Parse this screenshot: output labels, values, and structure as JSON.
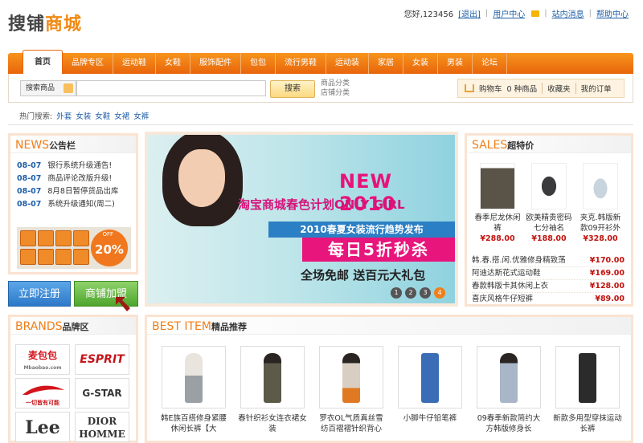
{
  "header": {
    "logo_part1": "搜铺",
    "logo_part2": "商城",
    "greeting": "您好,123456",
    "logout": "[退出]",
    "user_center": "用户中心",
    "messages": "站内消息",
    "help": "帮助中心"
  },
  "nav": {
    "tabs": [
      "首页",
      "品牌专区",
      "运动鞋",
      "女鞋",
      "服饰配件",
      "包包",
      "流行男鞋",
      "运动装",
      "家居",
      "女装",
      "男装",
      "论坛"
    ],
    "active_index": 0
  },
  "search": {
    "category": "搜索商品",
    "button": "搜索",
    "links": [
      "商品分类",
      "店铺分类"
    ]
  },
  "cart": {
    "cart_text": "购物车",
    "count_text": "0 种商品",
    "favorites": "收藏夹",
    "orders": "我的订单"
  },
  "hot_search": {
    "label": "热门搜索:",
    "keywords": [
      "外套",
      "女装",
      "女鞋",
      "女裙",
      "女裤"
    ]
  },
  "news": {
    "title_en": "NEWS",
    "title_cn": "公告栏",
    "items": [
      {
        "date": "08-07",
        "text": "银行系统升级通告!"
      },
      {
        "date": "08-07",
        "text": "商品评论改版升级!"
      },
      {
        "date": "08-07",
        "text": "8月8日暂停货品出库"
      },
      {
        "date": "08-07",
        "text": "系统升级通知(周二)"
      }
    ],
    "promo_off": "OFF",
    "promo_percent": "20%"
  },
  "actions": {
    "register": "立即注册",
    "join": "商铺加盟"
  },
  "banner": {
    "headline": "NEW 2010",
    "plan": "淘宝商城春色计划ONLY GIRL",
    "trend": "2010春夏女装流行趋势发布",
    "sale": "每日5折秒杀",
    "free": "全场免邮  送百元大礼包",
    "pages": [
      "1",
      "2",
      "3",
      "4"
    ],
    "active_page": 4
  },
  "sales": {
    "title_en": "SALES",
    "title_cn": "超特价",
    "featured": [
      {
        "name": "春季尼龙休闲裤",
        "price": "¥288.00"
      },
      {
        "name": "欧美精贵密码七分袖名",
        "price": "¥188.00"
      },
      {
        "name": "夹克.韩版新款09开衫外",
        "price": "¥328.00"
      }
    ],
    "list": [
      {
        "name": "韩.春.搭.闲.优雅修身精致荡",
        "price": "¥170.00"
      },
      {
        "name": "阿迪达斯花式运动鞋",
        "price": "¥169.00"
      },
      {
        "name": "春款韩版卡其休闲上衣",
        "price": "¥128.00"
      },
      {
        "name": "喜庆风格牛仔短裤",
        "price": "¥89.00"
      }
    ]
  },
  "brands": {
    "title_en": "BRANDS",
    "title_cn": "品牌区",
    "items": [
      "麦包包",
      "ESPRIT",
      "一切皆有可能",
      "G-STAR",
      "Lee",
      "DIOR HOMME"
    ],
    "maibaobao_sub": "Mbaobao.com"
  },
  "best": {
    "title_en": "BEST ITEM",
    "title_cn": "精品推荐",
    "items": [
      {
        "name": "韩E族百搭修身紧腰休闲长裤【大"
      },
      {
        "name": "春针织衫女连衣裙女装"
      },
      {
        "name": "罗衣OL气质真丝雪纺百褶褶针织背心"
      },
      {
        "name": "小脚牛仔铅笔裤"
      },
      {
        "name": "09春季新款简约大方韩版修身长"
      },
      {
        "name": "新款多用型穿抹运动长裤"
      }
    ]
  },
  "colors": {
    "accent": "#f07f19",
    "price": "#c2130e",
    "link": "#1f5fa8"
  }
}
